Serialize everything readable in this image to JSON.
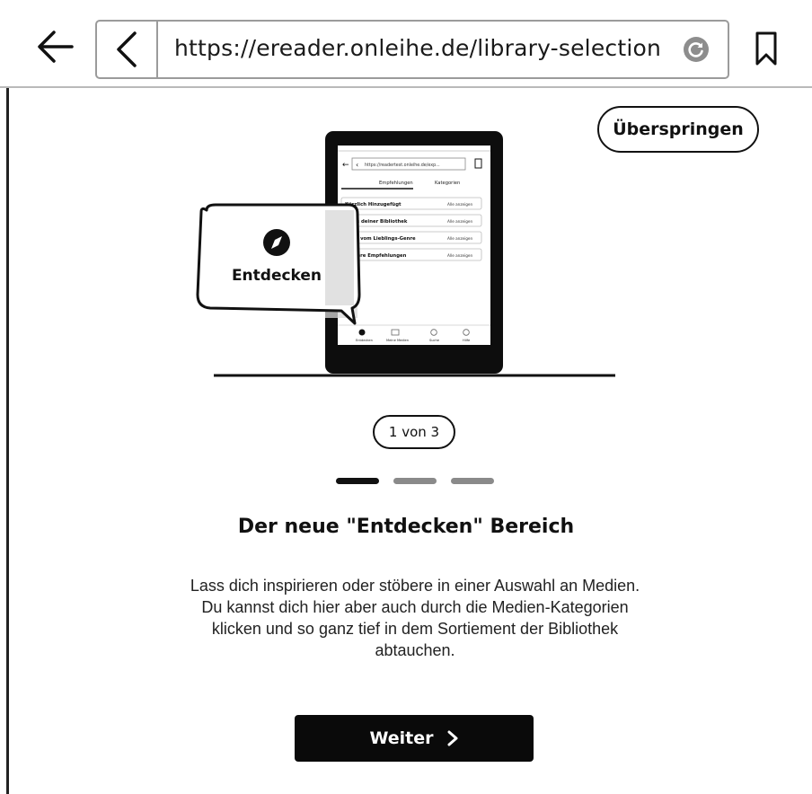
{
  "browser": {
    "url": "https://ereader.onleihe.de/library-selection",
    "icons": {
      "back": "arrow-left-icon",
      "url_back": "chevron-left-icon",
      "reload": "reload-icon",
      "bookmark": "bookmark-icon"
    }
  },
  "onboarding": {
    "skip_label": "Überspringen",
    "illustration": {
      "bubble_label": "Entdecken",
      "bubble_icon": "compass-icon",
      "device": {
        "url": "https://readertest.onleihe.de/exp...",
        "tabs": [
          "Empfehlungen",
          "Kategorien"
        ],
        "rows": [
          {
            "label": "Kürzlich Hinzugefügt",
            "action": "Alle anzeigen"
          },
          {
            "label": "Tipps deiner Bibliothek",
            "action": "Alle anzeigen"
          },
          {
            "label": "Mehr vom Lieblings-Genre",
            "action": "Alle anzeigen"
          },
          {
            "label": "Weitere Empfehlungen",
            "action": "Alle anzeigen"
          }
        ],
        "nav": [
          "Entdecken",
          "Meine Medien",
          "Suche",
          "Hilfe"
        ]
      }
    },
    "counter": "1 von 3",
    "pager": {
      "current": 1,
      "total": 3
    },
    "title": "Der neue \"Entdecken\" Bereich",
    "description_lines": [
      "Lass dich inspirieren oder stöbere in einer Auswahl an Medien.",
      "Du kannst dich hier aber auch durch die Medien-Kategorien",
      "klicken und so ganz tief in dem Sortiement der Bibliothek",
      "abtauchen."
    ],
    "next_label": "Weiter",
    "next_icon": "chevron-right-icon"
  },
  "colors": {
    "text": "#111111",
    "button_bg": "#0a0a0a",
    "button_text": "#ffffff",
    "pager_active": "#111111",
    "pager_inactive": "#8a8a8a"
  }
}
